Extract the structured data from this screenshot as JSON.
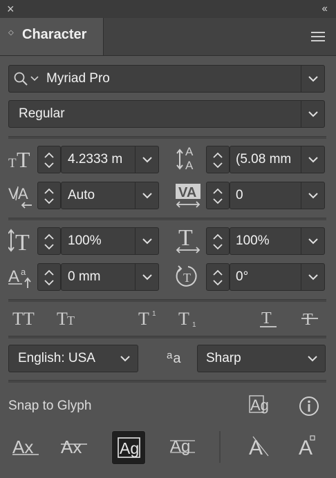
{
  "window": {
    "close": "×",
    "collapse": "‹‹"
  },
  "panel": {
    "tab_title": "Character",
    "menu_icon": "hamburger-menu-icon"
  },
  "font": {
    "family": "Myriad Pro",
    "style": "Regular"
  },
  "metrics": {
    "font_size": "4.2333 m",
    "leading": "(5.08 mm",
    "kerning": "Auto",
    "tracking": "0",
    "vertical_scale": "100%",
    "horizontal_scale": "100%",
    "baseline_shift": "0 mm",
    "rotation": "0°"
  },
  "type_style_buttons": [
    "All Caps",
    "Small Caps",
    "Superscript",
    "Subscript",
    "Underline",
    "Strikethrough"
  ],
  "language": "English: USA",
  "antialias": {
    "icon_text": "aa",
    "value": "Sharp"
  },
  "snap": {
    "label": "Snap to Glyph",
    "glyph_icon_text": "Ag",
    "info_icon_text": "i"
  },
  "snap_buttons": [
    {
      "text": "Ax",
      "name": "baseline"
    },
    {
      "text": "Ax",
      "name": "x-height"
    },
    {
      "text": "Ag",
      "name": "glyph-bounds",
      "active": true
    },
    {
      "text": "Ag",
      "name": "proximity-guides"
    },
    {
      "text": "A",
      "name": "angular-guides"
    },
    {
      "text": "A",
      "name": "anchor-point"
    }
  ],
  "colors": {
    "panel_bg": "#535353",
    "field_bg": "#3f3f3f",
    "active_bg": "#1f1f1f"
  }
}
